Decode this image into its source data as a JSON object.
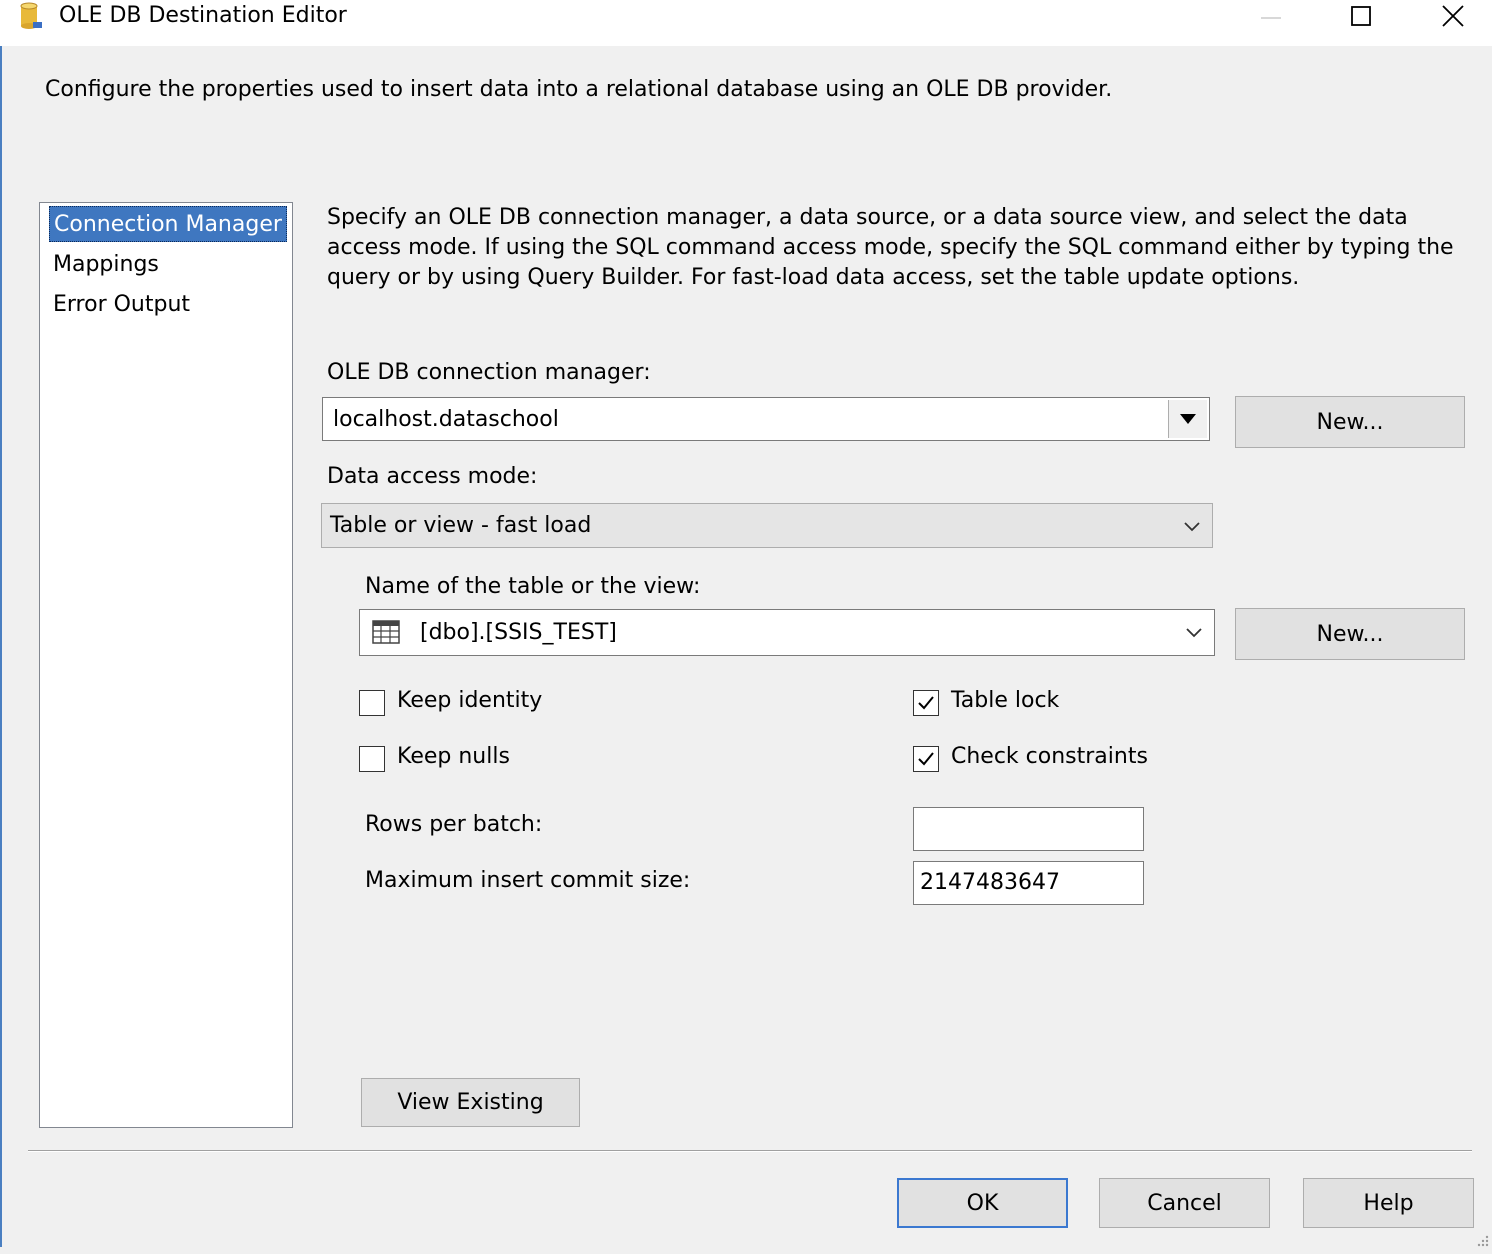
{
  "window": {
    "title": "OLE DB Destination Editor",
    "controls": {
      "minimize": "minimize-icon",
      "maximize": "maximize-icon",
      "close": "close-icon"
    },
    "icon": "database-cylinder-icon"
  },
  "header": {
    "description": "Configure the properties used to insert data into a relational database using an OLE DB provider."
  },
  "nav": {
    "items": [
      {
        "label": "Connection Manager",
        "selected": true
      },
      {
        "label": "Mappings",
        "selected": false
      },
      {
        "label": "Error Output",
        "selected": false
      }
    ]
  },
  "main": {
    "description": "Specify an OLE DB connection manager, a data source, or a data source view, and select the data access mode. If using the SQL command access mode, specify the SQL command either by typing the query or by using Query Builder. For fast-load data access, set the table update options.",
    "connection_manager": {
      "label": "OLE DB connection manager:",
      "value": "localhost.dataschool",
      "new_button": "New..."
    },
    "data_access_mode": {
      "label": "Data access mode:",
      "value": "Table or view - fast load"
    },
    "table": {
      "label": "Name of the table or the view:",
      "value": "[dbo].[SSIS_TEST]",
      "icon": "table-grid-icon",
      "new_button": "New..."
    },
    "options": {
      "keep_identity": {
        "label": "Keep identity",
        "checked": false
      },
      "keep_nulls": {
        "label": "Keep nulls",
        "checked": false
      },
      "table_lock": {
        "label": "Table lock",
        "checked": true
      },
      "check_constraints": {
        "label": "Check constraints",
        "checked": true
      }
    },
    "rows_per_batch": {
      "label": "Rows per batch:",
      "value": ""
    },
    "max_insert_commit_size": {
      "label": "Maximum insert commit size:",
      "value": "2147483647"
    },
    "view_existing_button": "View Existing"
  },
  "footer": {
    "ok": "OK",
    "cancel": "Cancel",
    "help": "Help"
  },
  "colors": {
    "dialog_bg": "#f0f0f0",
    "selection": "#3f77c0",
    "default_button_border": "#3b78d0"
  }
}
